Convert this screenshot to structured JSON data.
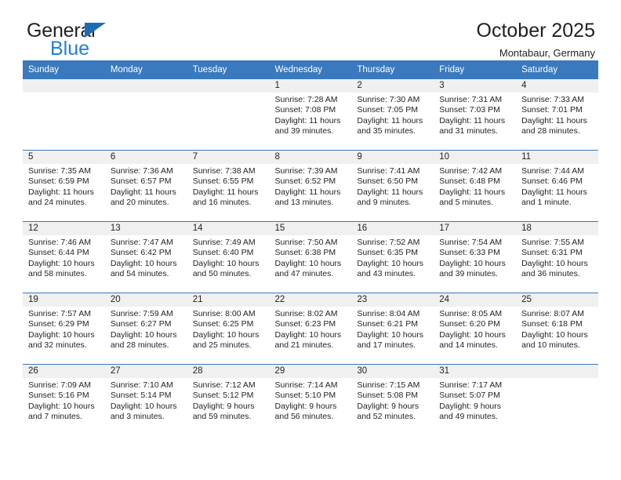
{
  "brand": {
    "name_part1": "General",
    "name_part2": "Blue",
    "logo_icon": "triangle-icon",
    "color_dark": "#231f20",
    "color_blue": "#1f7fd4",
    "triangle_color": "#1c6cb3"
  },
  "header": {
    "title": "October 2025",
    "subtitle": "Montabaur, Germany"
  },
  "colors": {
    "header_row_bg": "#3a79bd",
    "header_row_text": "#ffffff",
    "daynum_band_bg": "#f0f0f0",
    "row_divider": "#3a79bd",
    "body_text": "#231f20"
  },
  "calendar": {
    "weekday_headers": [
      "Sunday",
      "Monday",
      "Tuesday",
      "Wednesday",
      "Thursday",
      "Friday",
      "Saturday"
    ],
    "weeks": [
      [
        {
          "day": "",
          "empty": true,
          "sunrise": "",
          "sunset": "",
          "daylight": ""
        },
        {
          "day": "",
          "empty": true,
          "sunrise": "",
          "sunset": "",
          "daylight": ""
        },
        {
          "day": "",
          "empty": true,
          "sunrise": "",
          "sunset": "",
          "daylight": ""
        },
        {
          "day": "1",
          "empty": false,
          "sunrise": "Sunrise: 7:28 AM",
          "sunset": "Sunset: 7:08 PM",
          "daylight": "Daylight: 11 hours and 39 minutes."
        },
        {
          "day": "2",
          "empty": false,
          "sunrise": "Sunrise: 7:30 AM",
          "sunset": "Sunset: 7:05 PM",
          "daylight": "Daylight: 11 hours and 35 minutes."
        },
        {
          "day": "3",
          "empty": false,
          "sunrise": "Sunrise: 7:31 AM",
          "sunset": "Sunset: 7:03 PM",
          "daylight": "Daylight: 11 hours and 31 minutes."
        },
        {
          "day": "4",
          "empty": false,
          "sunrise": "Sunrise: 7:33 AM",
          "sunset": "Sunset: 7:01 PM",
          "daylight": "Daylight: 11 hours and 28 minutes."
        }
      ],
      [
        {
          "day": "5",
          "empty": false,
          "sunrise": "Sunrise: 7:35 AM",
          "sunset": "Sunset: 6:59 PM",
          "daylight": "Daylight: 11 hours and 24 minutes."
        },
        {
          "day": "6",
          "empty": false,
          "sunrise": "Sunrise: 7:36 AM",
          "sunset": "Sunset: 6:57 PM",
          "daylight": "Daylight: 11 hours and 20 minutes."
        },
        {
          "day": "7",
          "empty": false,
          "sunrise": "Sunrise: 7:38 AM",
          "sunset": "Sunset: 6:55 PM",
          "daylight": "Daylight: 11 hours and 16 minutes."
        },
        {
          "day": "8",
          "empty": false,
          "sunrise": "Sunrise: 7:39 AM",
          "sunset": "Sunset: 6:52 PM",
          "daylight": "Daylight: 11 hours and 13 minutes."
        },
        {
          "day": "9",
          "empty": false,
          "sunrise": "Sunrise: 7:41 AM",
          "sunset": "Sunset: 6:50 PM",
          "daylight": "Daylight: 11 hours and 9 minutes."
        },
        {
          "day": "10",
          "empty": false,
          "sunrise": "Sunrise: 7:42 AM",
          "sunset": "Sunset: 6:48 PM",
          "daylight": "Daylight: 11 hours and 5 minutes."
        },
        {
          "day": "11",
          "empty": false,
          "sunrise": "Sunrise: 7:44 AM",
          "sunset": "Sunset: 6:46 PM",
          "daylight": "Daylight: 11 hours and 1 minute."
        }
      ],
      [
        {
          "day": "12",
          "empty": false,
          "sunrise": "Sunrise: 7:46 AM",
          "sunset": "Sunset: 6:44 PM",
          "daylight": "Daylight: 10 hours and 58 minutes."
        },
        {
          "day": "13",
          "empty": false,
          "sunrise": "Sunrise: 7:47 AM",
          "sunset": "Sunset: 6:42 PM",
          "daylight": "Daylight: 10 hours and 54 minutes."
        },
        {
          "day": "14",
          "empty": false,
          "sunrise": "Sunrise: 7:49 AM",
          "sunset": "Sunset: 6:40 PM",
          "daylight": "Daylight: 10 hours and 50 minutes."
        },
        {
          "day": "15",
          "empty": false,
          "sunrise": "Sunrise: 7:50 AM",
          "sunset": "Sunset: 6:38 PM",
          "daylight": "Daylight: 10 hours and 47 minutes."
        },
        {
          "day": "16",
          "empty": false,
          "sunrise": "Sunrise: 7:52 AM",
          "sunset": "Sunset: 6:35 PM",
          "daylight": "Daylight: 10 hours and 43 minutes."
        },
        {
          "day": "17",
          "empty": false,
          "sunrise": "Sunrise: 7:54 AM",
          "sunset": "Sunset: 6:33 PM",
          "daylight": "Daylight: 10 hours and 39 minutes."
        },
        {
          "day": "18",
          "empty": false,
          "sunrise": "Sunrise: 7:55 AM",
          "sunset": "Sunset: 6:31 PM",
          "daylight": "Daylight: 10 hours and 36 minutes."
        }
      ],
      [
        {
          "day": "19",
          "empty": false,
          "sunrise": "Sunrise: 7:57 AM",
          "sunset": "Sunset: 6:29 PM",
          "daylight": "Daylight: 10 hours and 32 minutes."
        },
        {
          "day": "20",
          "empty": false,
          "sunrise": "Sunrise: 7:59 AM",
          "sunset": "Sunset: 6:27 PM",
          "daylight": "Daylight: 10 hours and 28 minutes."
        },
        {
          "day": "21",
          "empty": false,
          "sunrise": "Sunrise: 8:00 AM",
          "sunset": "Sunset: 6:25 PM",
          "daylight": "Daylight: 10 hours and 25 minutes."
        },
        {
          "day": "22",
          "empty": false,
          "sunrise": "Sunrise: 8:02 AM",
          "sunset": "Sunset: 6:23 PM",
          "daylight": "Daylight: 10 hours and 21 minutes."
        },
        {
          "day": "23",
          "empty": false,
          "sunrise": "Sunrise: 8:04 AM",
          "sunset": "Sunset: 6:21 PM",
          "daylight": "Daylight: 10 hours and 17 minutes."
        },
        {
          "day": "24",
          "empty": false,
          "sunrise": "Sunrise: 8:05 AM",
          "sunset": "Sunset: 6:20 PM",
          "daylight": "Daylight: 10 hours and 14 minutes."
        },
        {
          "day": "25",
          "empty": false,
          "sunrise": "Sunrise: 8:07 AM",
          "sunset": "Sunset: 6:18 PM",
          "daylight": "Daylight: 10 hours and 10 minutes."
        }
      ],
      [
        {
          "day": "26",
          "empty": false,
          "sunrise": "Sunrise: 7:09 AM",
          "sunset": "Sunset: 5:16 PM",
          "daylight": "Daylight: 10 hours and 7 minutes."
        },
        {
          "day": "27",
          "empty": false,
          "sunrise": "Sunrise: 7:10 AM",
          "sunset": "Sunset: 5:14 PM",
          "daylight": "Daylight: 10 hours and 3 minutes."
        },
        {
          "day": "28",
          "empty": false,
          "sunrise": "Sunrise: 7:12 AM",
          "sunset": "Sunset: 5:12 PM",
          "daylight": "Daylight: 9 hours and 59 minutes."
        },
        {
          "day": "29",
          "empty": false,
          "sunrise": "Sunrise: 7:14 AM",
          "sunset": "Sunset: 5:10 PM",
          "daylight": "Daylight: 9 hours and 56 minutes."
        },
        {
          "day": "30",
          "empty": false,
          "sunrise": "Sunrise: 7:15 AM",
          "sunset": "Sunset: 5:08 PM",
          "daylight": "Daylight: 9 hours and 52 minutes."
        },
        {
          "day": "31",
          "empty": false,
          "sunrise": "Sunrise: 7:17 AM",
          "sunset": "Sunset: 5:07 PM",
          "daylight": "Daylight: 9 hours and 49 minutes."
        },
        {
          "day": "",
          "empty": true,
          "sunrise": "",
          "sunset": "",
          "daylight": ""
        }
      ]
    ]
  }
}
